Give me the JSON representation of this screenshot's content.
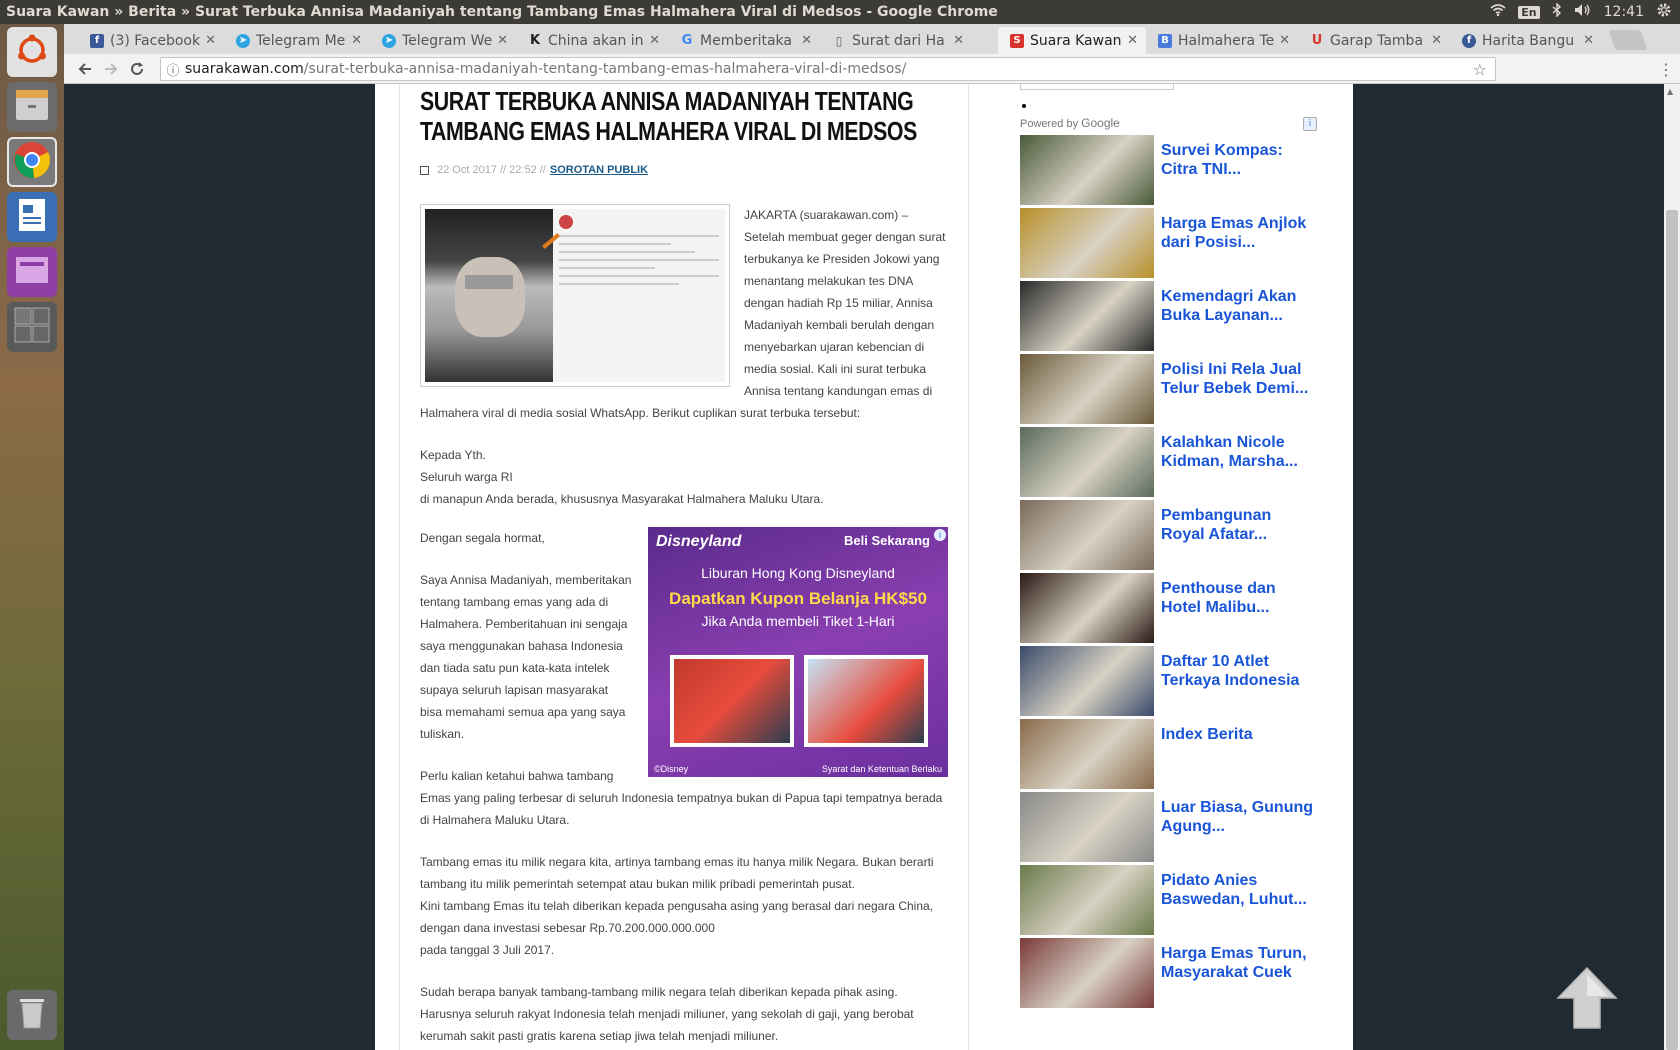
{
  "window_title": "Suara Kawan » Berita » Surat Terbuka Annisa Madaniyah tentang Tambang Emas Halmahera Viral di Medsos - Google Chrome",
  "tray": {
    "keyboard": "En",
    "time": "12:41"
  },
  "tabs": [
    {
      "label": "(3) Facebook",
      "color": "#3b5998",
      "glyph": "f"
    },
    {
      "label": "Telegram Me",
      "color": "#2ca5e0",
      "glyph": "➤"
    },
    {
      "label": "Telegram We",
      "color": "#2ca5e0",
      "glyph": "➤"
    },
    {
      "label": "China akan in",
      "color": "#ffffff",
      "glyph": "K"
    },
    {
      "label": "Memberitaka",
      "color": "#ffffff",
      "glyph": "G"
    },
    {
      "label": "Surat dari Ha",
      "color": "#ffffff",
      "glyph": "▯"
    },
    {
      "label": "Suara Kawan",
      "color": "#d9342b",
      "glyph": "S"
    },
    {
      "label": "Halmahera Te",
      "color": "#4a7adb",
      "glyph": "B"
    },
    {
      "label": "Garap Tamba",
      "color": "#d9342b",
      "glyph": "U"
    },
    {
      "label": "Harita Bangu",
      "color": "#3b5998",
      "glyph": "f"
    }
  ],
  "address": {
    "host": "suarakawan.com",
    "path": "/surat-terbuka-annisa-madaniyah-tentang-tambang-emas-halmahera-viral-di-medsos/"
  },
  "article": {
    "title": "Surat Terbuka Annisa Madaniyah Tentang Tambang Emas Halmahera Viral Di Medsos",
    "date": "22 Oct 2017 // 22:52 //",
    "category": "SOROTAN PUBLIK",
    "intro": "JAKARTA (suarakawan.com) – Setelah membuat geger dengan surat terbukanya ke Presiden Jokowi yang menantang melakukan tes DNA dengan hadiah Rp 15 miliar, Annisa Madaniyah kembali berulah dengan menyebarkan ujaran kebencian di media sosial. Kali ini surat terbuka Annisa tentang kandungan emas di Halmahera viral di media sosial WhatsApp. Berikut cuplikan surat terbuka tersebut:",
    "greeting1": "Kepada Yth.",
    "greeting2": "Seluruh warga RI",
    "greeting3": "di manapun Anda berada, khususnya Masyarakat Halmahera Maluku Utara.",
    "salam": "Dengan segala hormat,",
    "p1": "Saya Annisa Madaniyah, memberitakan tentang tambang emas yang ada di Halmahera. Pemberitahuan ini sengaja saya menggunakan bahasa Indonesia dan tiada satu pun kata-kata intelek supaya seluruh lapisan masyarakat bisa memahami semua apa yang saya tuliskan.",
    "p2": "Perlu kalian ketahui bahwa tambang Emas yang paling terbesar di seluruh Indonesia tempatnya bukan di Papua tapi tempatnya berada di Halmahera Maluku Utara.",
    "p3a": "Tambang emas itu milik negara kita, artinya tambang emas itu hanya milik Negara. Bukan berarti tambang itu milik pemerintah setempat atau bukan milik pribadi pemerintah pusat.",
    "p3b": "Kini tambang Emas itu telah diberikan kepada pengusaha asing yang berasal dari negara China, dengan dana investasi sebesar Rp.70.200.000.000.000",
    "p3c": "pada tanggal 3 Juli 2017.",
    "p4": "Sudah berapa banyak tambang-tambang milik negara telah diberikan kepada pihak asing. Harusnya seluruh rakyat Indonesia telah menjadi miliuner, yang sekolah di gaji, yang berobat kerumah sakit pasti gratis karena setiap jiwa telah menjadi miliuner."
  },
  "ad": {
    "brand": "Disneyland",
    "cta": "Beli Sekarang",
    "line1": "Liburan Hong Kong Disneyland",
    "line2": "Dapatkan Kupon Belanja HK$50",
    "line3": "Jika Anda membeli Tiket 1-Hari",
    "footer_left": "©Disney",
    "footer_right": "Syarat dan Ketentuan Berlaku"
  },
  "sidebar": {
    "powered_by": "Powered by",
    "google": "Google",
    "related": [
      {
        "title": "Survei Kompas: Citra TNI...",
        "thumb": "#4a5a3a"
      },
      {
        "title": "Harga Emas Anjlok dari Posisi...",
        "thumb": "#b8902a"
      },
      {
        "title": "Kemendagri Akan Buka Layanan...",
        "thumb": "#2a2a2a"
      },
      {
        "title": "Polisi Ini Rela Jual Telur Bebek Demi...",
        "thumb": "#6a5a3a"
      },
      {
        "title": "Kalahkan Nicole Kidman, Marsha...",
        "thumb": "#5a6a5a"
      },
      {
        "title": "Pembangunan Royal Afatar...",
        "thumb": "#7a6a5a"
      },
      {
        "title": "Penthouse dan Hotel Malibu...",
        "thumb": "#2a1a14"
      },
      {
        "title": "Daftar 10 Atlet Terkaya Indonesia",
        "thumb": "#3a4a6a"
      },
      {
        "title": "Index Berita",
        "thumb": "#8a6a4a"
      },
      {
        "title": "Luar Biasa, Gunung Agung...",
        "thumb": "#8a8a8a"
      },
      {
        "title": "Pidato Anies Baswedan, Luhut...",
        "thumb": "#6a7a4a"
      },
      {
        "title": "Harga Emas Turun, Masyarakat Cuek",
        "thumb": "#7a3a3a"
      }
    ]
  }
}
